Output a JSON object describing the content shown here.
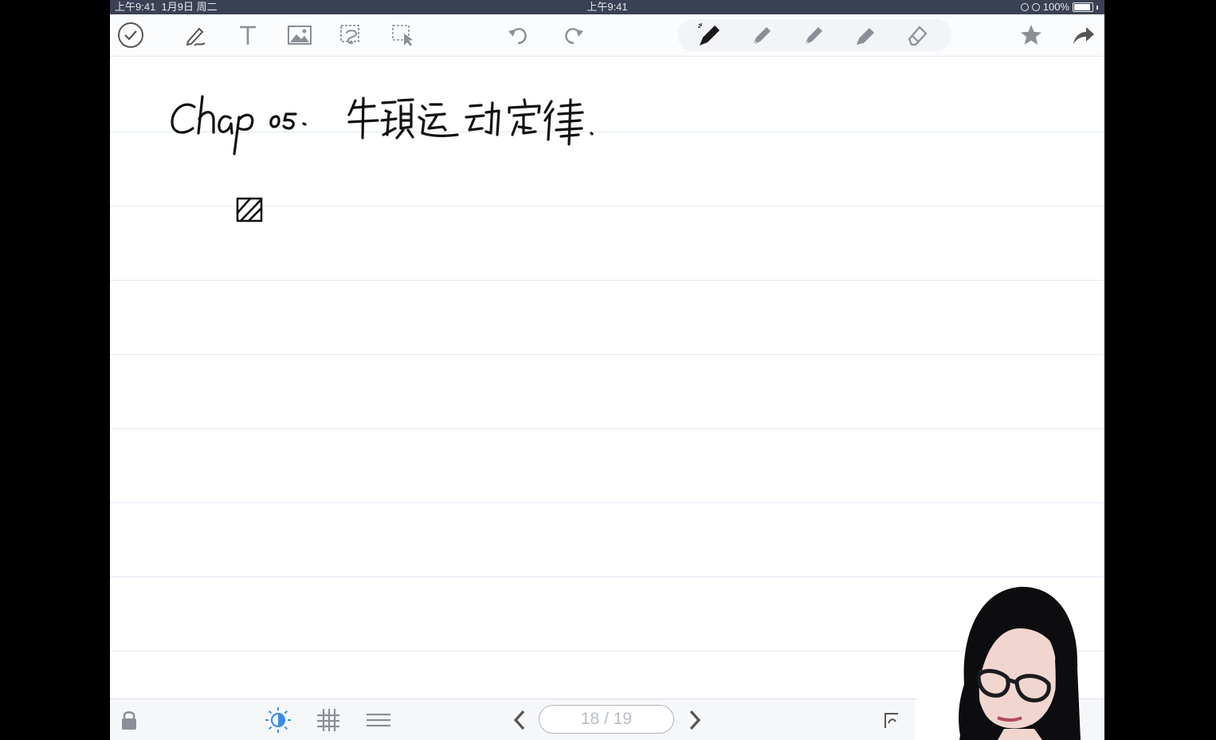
{
  "status_bar": {
    "left_time": "上午9:41",
    "date": "1月9日 周二",
    "center_time": "上午9:41",
    "battery": "100%",
    "battery_level": 1.0
  },
  "toolbar": {
    "left_tools": [
      "done-check",
      "pen",
      "text",
      "image",
      "lasso",
      "select"
    ],
    "history": [
      "undo",
      "redo"
    ],
    "pens": [
      "pen-active",
      "pen-2",
      "pen-3",
      "highlighter",
      "eraser"
    ],
    "right_tools": [
      "favorite-star",
      "share"
    ]
  },
  "note": {
    "title_latin": "Chap 05.",
    "title_chinese": "牛顿运动定律.",
    "symbol": "hatched-square"
  },
  "bottom_bar": {
    "page_indicator": "18 / 19",
    "current_page": 18,
    "total_pages": 19
  },
  "colors": {
    "status_bar": "#3b4155",
    "accent_blue": "#3a8ee6",
    "ink": "#111111",
    "rule_line": "#dfeaf3"
  }
}
